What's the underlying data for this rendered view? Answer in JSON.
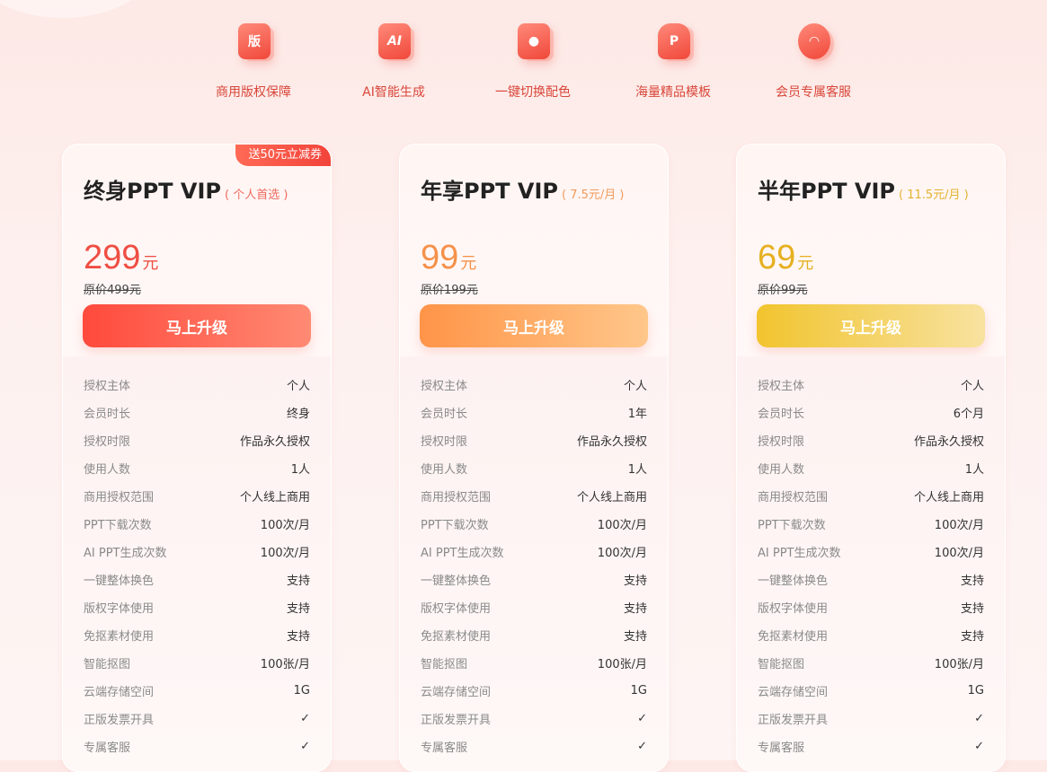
{
  "features": [
    {
      "label": "商用版权保障",
      "icon": "copyright-shield-icon",
      "glyph": "版"
    },
    {
      "label": "AI智能生成",
      "icon": "ai-icon",
      "glyph": "AI"
    },
    {
      "label": "一键切换配色",
      "icon": "palette-icon",
      "glyph": "●"
    },
    {
      "label": "海量精品模板",
      "icon": "template-icon",
      "glyph": "P"
    },
    {
      "label": "会员专属客服",
      "icon": "customer-service-icon",
      "glyph": "◠"
    }
  ],
  "plans": [
    {
      "badge": "送50元立减券",
      "title": "终身PPT VIP",
      "subtitle": "( 个人首选 )",
      "price": "299",
      "unit": "元",
      "original": "原价499元",
      "button": "马上升级",
      "accent": "#ef4e43",
      "subtitle_color": "#ef6a5f",
      "button_gradient": [
        "#ff4a3d",
        "#ff8a73"
      ],
      "rows": [
        {
          "k": "授权主体",
          "v": "个人"
        },
        {
          "k": "会员时长",
          "v": "终身"
        },
        {
          "k": "授权时限",
          "v": "作品永久授权"
        },
        {
          "k": "使用人数",
          "v": "1人"
        },
        {
          "k": "商用授权范围",
          "v": "个人线上商用"
        },
        {
          "k": "PPT下载次数",
          "v": "100次/月"
        },
        {
          "k": "AI PPT生成次数",
          "v": "100次/月"
        },
        {
          "k": "一键整体换色",
          "v": "支持"
        },
        {
          "k": "版权字体使用",
          "v": "支持"
        },
        {
          "k": "免抠素材使用",
          "v": "支持"
        },
        {
          "k": "智能抠图",
          "v": "100张/月"
        },
        {
          "k": "云端存储空间",
          "v": "1G"
        },
        {
          "k": "正版发票开具",
          "v": "✓"
        },
        {
          "k": "专属客服",
          "v": "✓"
        }
      ]
    },
    {
      "badge": "",
      "title": "年享PPT VIP",
      "subtitle": "( 7.5元/月 )",
      "price": "99",
      "unit": "元",
      "original": "原价199元",
      "button": "马上升级",
      "accent": "#f5914a",
      "subtitle_color": "#f29a5a",
      "button_gradient": [
        "#ff9448",
        "#ffc78a"
      ],
      "rows": [
        {
          "k": "授权主体",
          "v": "个人"
        },
        {
          "k": "会员时长",
          "v": "1年"
        },
        {
          "k": "授权时限",
          "v": "作品永久授权"
        },
        {
          "k": "使用人数",
          "v": "1人"
        },
        {
          "k": "商用授权范围",
          "v": "个人线上商用"
        },
        {
          "k": "PPT下载次数",
          "v": "100次/月"
        },
        {
          "k": "AI PPT生成次数",
          "v": "100次/月"
        },
        {
          "k": "一键整体换色",
          "v": "支持"
        },
        {
          "k": "版权字体使用",
          "v": "支持"
        },
        {
          "k": "免抠素材使用",
          "v": "支持"
        },
        {
          "k": "智能抠图",
          "v": "100张/月"
        },
        {
          "k": "云端存储空间",
          "v": "1G"
        },
        {
          "k": "正版发票开具",
          "v": "✓"
        },
        {
          "k": "专属客服",
          "v": "✓"
        }
      ]
    },
    {
      "badge": "",
      "title": "半年PPT VIP",
      "subtitle": "( 11.5元/月 )",
      "price": "69",
      "unit": "元",
      "original": "原价99元",
      "button": "马上升级",
      "accent": "#e6b021",
      "subtitle_color": "#e3b22e",
      "button_gradient": [
        "#f1c42e",
        "#f8e2a0"
      ],
      "rows": [
        {
          "k": "授权主体",
          "v": "个人"
        },
        {
          "k": "会员时长",
          "v": "6个月"
        },
        {
          "k": "授权时限",
          "v": "作品永久授权"
        },
        {
          "k": "使用人数",
          "v": "1人"
        },
        {
          "k": "商用授权范围",
          "v": "个人线上商用"
        },
        {
          "k": "PPT下载次数",
          "v": "100次/月"
        },
        {
          "k": "AI PPT生成次数",
          "v": "100次/月"
        },
        {
          "k": "一键整体换色",
          "v": "支持"
        },
        {
          "k": "版权字体使用",
          "v": "支持"
        },
        {
          "k": "免抠素材使用",
          "v": "支持"
        },
        {
          "k": "智能抠图",
          "v": "100张/月"
        },
        {
          "k": "云端存储空间",
          "v": "1G"
        },
        {
          "k": "正版发票开具",
          "v": "✓"
        },
        {
          "k": "专属客服",
          "v": "✓"
        }
      ]
    }
  ]
}
